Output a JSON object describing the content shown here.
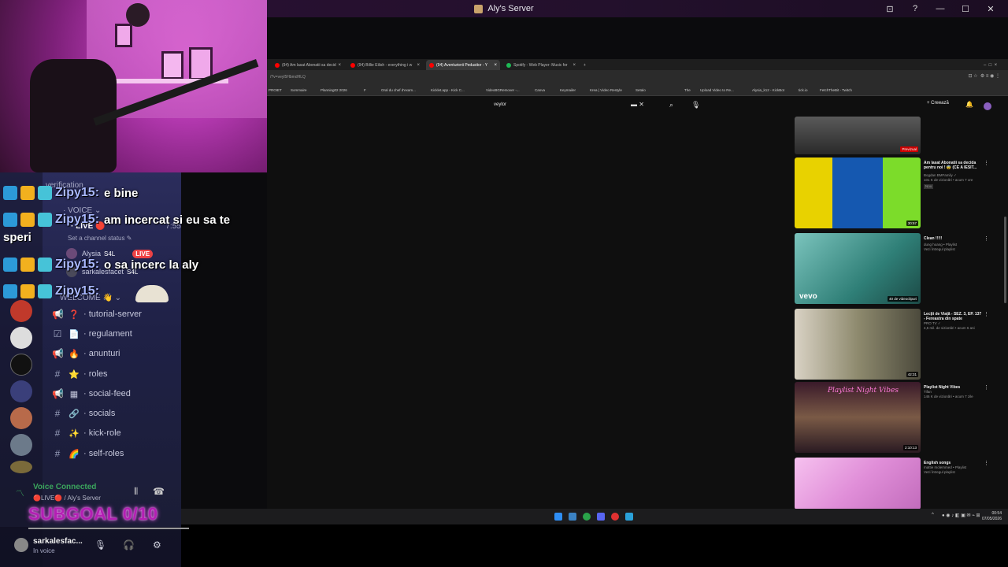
{
  "window": {
    "title": "Aly's Server",
    "actions": [
      "⊡",
      "?",
      "—",
      "☐",
      "✕"
    ]
  },
  "chat": {
    "messages": [
      {
        "user": "Zipy15:",
        "text": "e bine"
      },
      {
        "user": "Zipy15:",
        "text": "am incercat si eu sa te"
      },
      {
        "user": "",
        "text": "speri"
      },
      {
        "user": "Zipy15:",
        "text": "o sa incerc la aly"
      },
      {
        "user": "Zipy15:",
        "text": ""
      }
    ],
    "subgoal": "SUBGOAL 0/10"
  },
  "discord": {
    "headers": {
      "verification": "verification",
      "voice": "· VOICE ⌄",
      "welcome": "WELCOME 👋 ⌄"
    },
    "live_channel": {
      "label": "· LIVE 🔴",
      "time": "7:55",
      "status": "Set a channel status ✎"
    },
    "voice_users": [
      {
        "name": "Alysia",
        "tag": "S4L",
        "live": "LIVE"
      },
      {
        "name": "sarkalesfacet",
        "tag": "S4L",
        "live": ""
      }
    ],
    "channels": [
      {
        "icon": "📢",
        "emoji": "❓",
        "name": "· tutorial-server"
      },
      {
        "icon": "☑",
        "emoji": "📄",
        "name": "· regulament"
      },
      {
        "icon": "📢",
        "emoji": "🔥",
        "name": "· anunturi"
      },
      {
        "icon": "#",
        "emoji": "⭐",
        "name": "· roles"
      },
      {
        "icon": "📢",
        "emoji": "▦",
        "name": "· social-feed"
      },
      {
        "icon": "#",
        "emoji": "🔗",
        "name": "· socials"
      },
      {
        "icon": "#",
        "emoji": "✨",
        "name": "· kick-role"
      },
      {
        "icon": "#",
        "emoji": "🌈",
        "name": "· self-roles"
      }
    ],
    "voice_panel": {
      "title": "Voice Connected",
      "subtitle": "🔴LIVE🔴 / Aly's Server"
    },
    "user": {
      "name": "sarkalesfac...",
      "status": "In voice"
    }
  },
  "browser": {
    "tabs": [
      {
        "label": "(94) Am lasat Abonatii sa decid",
        "color": "#ff0000"
      },
      {
        "label": "(94) Billie Eilish - everything i w",
        "color": "#ff0000"
      },
      {
        "label": "(94) Aventurierii Pedusitor - Y",
        "color": "#ff0000"
      },
      {
        "label": "Spotify - Web Player: Music for",
        "color": "#1db954"
      }
    ],
    "url": "/?v=veyl5HbmdHLQ",
    "bookmarks": [
      "PROIET",
      "Sommaire",
      "Planning02 2026",
      "F",
      "Oral du chef d'exam...",
      "Kicklet.app - Kick C...",
      "VideoBGRemover -...",
      "Canva",
      "Keymailer",
      "Krea | Video Restyle",
      "Setalo",
      "The",
      "Upload Video to Re...",
      "Alysia_k12 - KickBot",
      "tick.io",
      "FetchTheBit - Twitch"
    ],
    "search_query": "veylor",
    "create_label": "+ Creează",
    "videos": [
      {
        "title": "",
        "meta1": "",
        "meta2": "",
        "duration": "Previzual",
        "palette": [
          "#4a4a4a",
          "#2a2a2a"
        ]
      },
      {
        "title": "Am lasat Abonatii sa decida pentru noi ! 😨 (CE A IESIT...",
        "meta1": "Bogdan BMFamily ✓",
        "meta2": "101 K de vizionări • acum 7 ore",
        "extra": "Nou",
        "duration": "30:57",
        "palette": [
          "#e8d200",
          "#0f60c0"
        ]
      },
      {
        "title": "Clean !!!!!",
        "meta1": "dung hoang • Playlist",
        "meta2": "Vezi întregul playlist",
        "duration": "40 de videoclipuri",
        "palette": [
          "#4ea7a0",
          "#1c6a62"
        ]
      },
      {
        "title": "Lecții de Viață - SEZ. 3, EP. 137 - Fereastra din spate",
        "meta1": "PRO TV ✓",
        "meta2": "4,5 mil. de vizionări • acum 6 ani",
        "duration": "42:31",
        "palette": [
          "#c9c2b4",
          "#6a6a4e"
        ]
      },
      {
        "title": "Playlist Night Vibes",
        "meta1": "Tifan",
        "meta2": "146 K de vizionări • acum 7 zile",
        "overlay": "Playlist Night Vibes",
        "duration": "2:10:13",
        "palette": [
          "#6b4a3a",
          "#2a1a22"
        ]
      },
      {
        "title": "English songs",
        "meta1": "mattie molemmed • Playlist",
        "meta2": "Vezi întregul playlist",
        "duration": "",
        "palette": [
          "#f0a6e8",
          "#cf6fc9"
        ]
      }
    ]
  },
  "taskbar": {
    "time": "00:54",
    "date": "07/05/2026",
    "tray": "^"
  }
}
